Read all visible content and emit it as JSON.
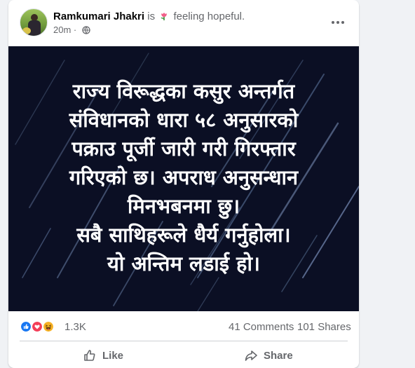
{
  "post": {
    "author": "Ramkumari Jhakri",
    "is_word": "is",
    "feeling": "feeling hopeful.",
    "feeling_icon": "tulip-emoji-icon",
    "timestamp": "20m",
    "privacy": "·",
    "audience_icon": "globe-icon"
  },
  "image": {
    "lines": [
      "राज्य विरूद्धका कसुर अन्तर्गत",
      "संविधानको धारा ५८ अनुसारको",
      "पक्राउ पूर्जी जारी गरी गिरफ्तार",
      "गरिएको छ। अपराध अनुसन्धान",
      "मिनभबनमा छु।",
      "सबै साथिहरूले धैर्य गर्नुहोला।",
      "यो अन्तिम लडाई हो।"
    ]
  },
  "stats": {
    "reaction_count": "1.3K",
    "comments": "41 Comments",
    "shares": "101 Shares",
    "reaction_icons": [
      "like-icon",
      "love-icon",
      "haha-icon"
    ]
  },
  "actions": {
    "like": "Like",
    "share": "Share"
  },
  "colors": {
    "like": "#1877f2",
    "love": "#f33e58",
    "haha": "#f7b125",
    "image_bg": "#0b0f24"
  }
}
